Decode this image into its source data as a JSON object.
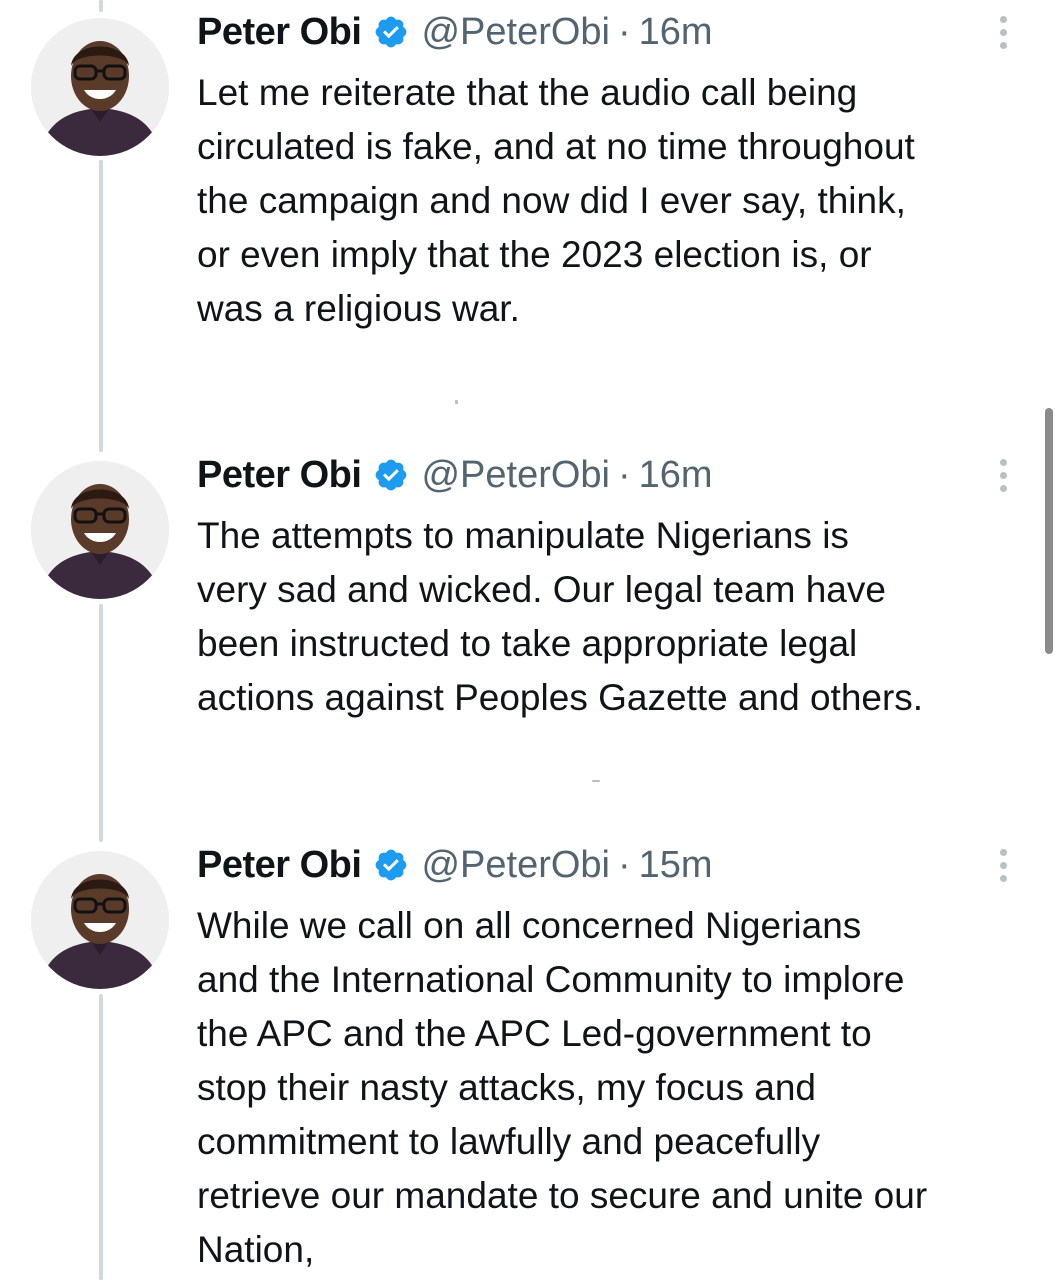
{
  "tweets": [
    {
      "display_name": "Peter Obi",
      "handle": "@PeterObi",
      "separator": "·",
      "timestamp": "16m",
      "text": "Let me reiterate that the audio call being\ncirculated is fake, and at no time throughout\nthe campaign and now did I ever say, think,\nor even imply that the 2023 election is, or\nwas a religious war."
    },
    {
      "display_name": "Peter Obi",
      "handle": "@PeterObi",
      "separator": "·",
      "timestamp": "16m",
      "text": "The attempts to manipulate Nigerians is\nvery sad and wicked. Our legal team have\nbeen instructed to take appropriate legal\nactions against Peoples Gazette and others."
    },
    {
      "display_name": "Peter Obi",
      "handle": "@PeterObi",
      "separator": "·",
      "timestamp": "15m",
      "text": "While we call on all concerned Nigerians\nand the International Community to implore\nthe APC and the APC Led-government to\nstop their nasty attacks, my focus and\ncommitment to lawfully and peacefully\nretrieve our mandate to secure and unite our\nNation,"
    }
  ],
  "icons": {
    "verified": "verified-badge-icon",
    "more": "more-options-icon"
  },
  "colors": {
    "verified_blue": "#1d9bf0",
    "text": "#0f1419",
    "secondary_text": "#536471",
    "thread_line": "#cfd9de"
  }
}
